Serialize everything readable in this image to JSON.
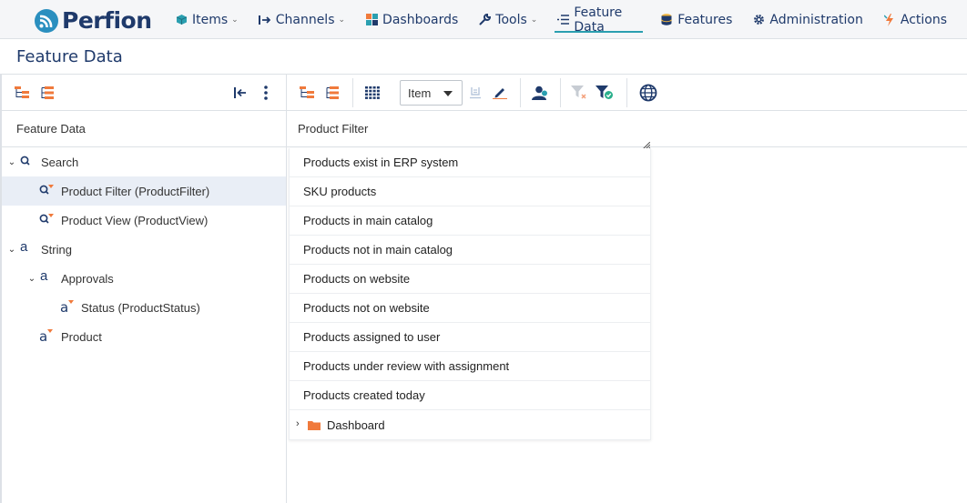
{
  "app": {
    "logo_text": "Perfion"
  },
  "nav": [
    {
      "label": "Items",
      "icon": "cube-icon",
      "has_menu": true
    },
    {
      "label": "Channels",
      "icon": "channel-arrow-icon",
      "has_menu": true
    },
    {
      "label": "Dashboards",
      "icon": "dashboard-grid-icon",
      "has_menu": false
    },
    {
      "label": "Tools",
      "icon": "wrench-icon",
      "has_menu": true
    },
    {
      "label": "Feature Data",
      "icon": "list-icon",
      "has_menu": false,
      "active": true
    },
    {
      "label": "Features",
      "icon": "database-icon",
      "has_menu": false
    },
    {
      "label": "Administration",
      "icon": "gear-icon",
      "has_menu": false
    },
    {
      "label": "Actions",
      "icon": "lightning-icon",
      "has_menu": false
    }
  ],
  "page": {
    "title": "Feature Data"
  },
  "left_panel": {
    "header": "Feature Data",
    "tree": [
      {
        "label": "Search",
        "icon": "search-icon",
        "expanded": true,
        "level": 0
      },
      {
        "label": "Product Filter (ProductFilter)",
        "icon": "search-filter-icon",
        "level": 1,
        "selected": true
      },
      {
        "label": "Product View (ProductView)",
        "icon": "search-filter-icon",
        "level": 1
      },
      {
        "label": "String",
        "icon": "string-icon",
        "expanded": true,
        "level": 0
      },
      {
        "label": "Approvals",
        "icon": "string-icon",
        "expanded": true,
        "level": 1
      },
      {
        "label": "Status (ProductStatus)",
        "icon": "string-feature-icon",
        "level": 2
      },
      {
        "label": "Product",
        "icon": "string-feature-icon",
        "level": 1
      }
    ]
  },
  "right_panel": {
    "item_select": {
      "value": "Item"
    },
    "header": "Product Filter",
    "filters": [
      "Products exist in ERP system",
      "SKU products",
      "Products in main catalog",
      "Products not in main catalog",
      "Products on website",
      "Products not on website",
      "Products assigned to user",
      "Products under review with assignment",
      "Products created today"
    ],
    "folder": {
      "label": "Dashboard",
      "icon": "folder-icon"
    }
  },
  "colors": {
    "brand": "#1f3a6b",
    "accent": "#2a9fb0",
    "orange": "#f07a3c"
  }
}
